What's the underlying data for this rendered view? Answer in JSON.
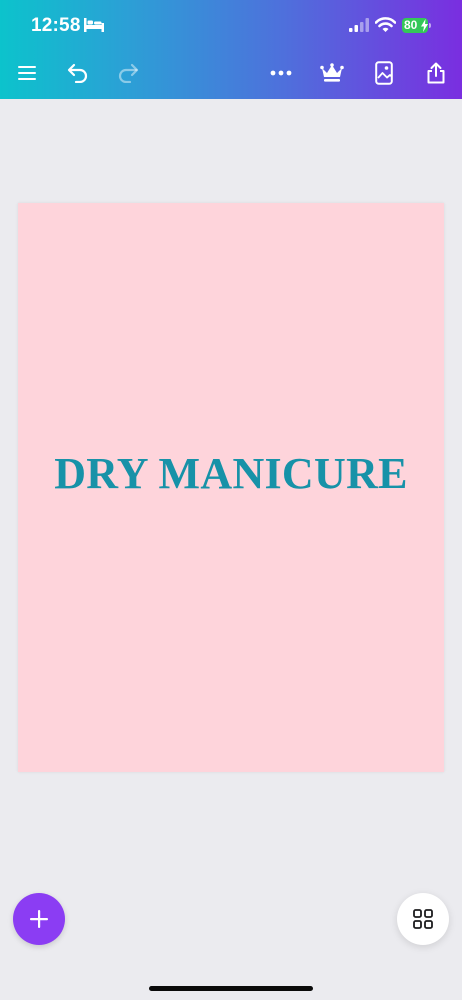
{
  "status_bar": {
    "time": "12:58",
    "battery": "80",
    "icons": [
      "bed-icon",
      "cellular-signal-icon",
      "wifi-icon",
      "battery-icon",
      "charging-bolt-icon"
    ]
  },
  "toolbar": {
    "icons": [
      "menu-icon",
      "undo-icon",
      "redo-icon",
      "more-icon",
      "crown-icon",
      "resize-icon",
      "share-icon"
    ],
    "redo_enabled": false
  },
  "design": {
    "title": "DRY MANICURE",
    "background_color": "#fed4db",
    "text_color": "#1792a8"
  },
  "bottom": {
    "icons": [
      "plus-icon",
      "grid-icon"
    ]
  },
  "colors": {
    "gradient_start": "#0cc3cc",
    "gradient_end": "#7a2ee0",
    "fab_accent": "#8b3df3",
    "workspace": "#ebebef"
  }
}
